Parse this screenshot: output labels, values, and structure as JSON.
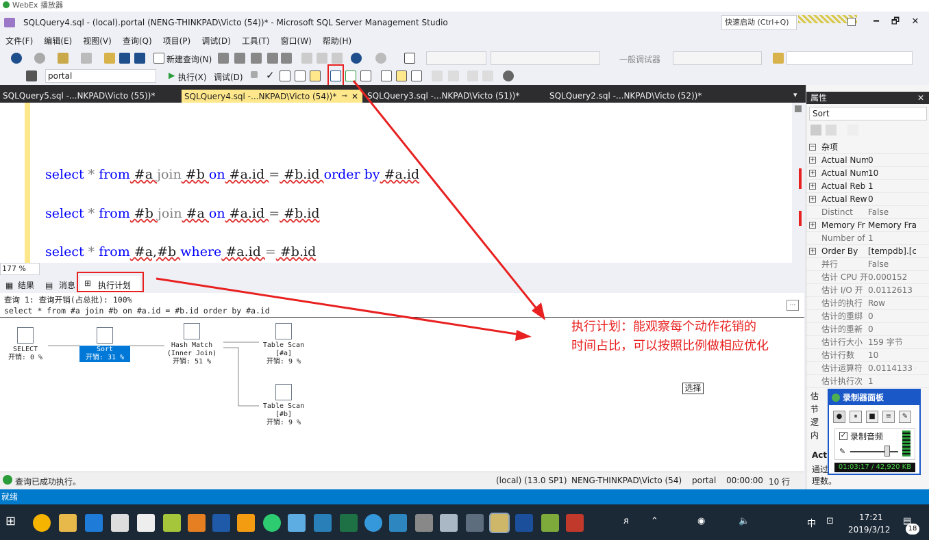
{
  "webex": {
    "title": "WebEx 播放器"
  },
  "window": {
    "title": "SQLQuery4.sql - (local).portal (NENG-THINKPAD\\Victo (54))* - Microsoft SQL Server Management Studio",
    "quick_launch": "快速启动 (Ctrl+Q)",
    "minimize": "━",
    "restore": "🗗",
    "close": "✕"
  },
  "menu": [
    "文件(F)",
    "编辑(E)",
    "视图(V)",
    "查询(Q)",
    "项目(P)",
    "调试(D)",
    "工具(T)",
    "窗口(W)",
    "帮助(H)"
  ],
  "toolbar1": {
    "new_query": "新建查询(N)",
    "debugger": "一般调试器"
  },
  "toolbar2": {
    "database": "portal",
    "execute": "执行(X)",
    "debug": "调试(D)"
  },
  "doc_tabs": [
    {
      "label": "SQLQuery5.sql -...NKPAD\\Victo (55))*",
      "active": false
    },
    {
      "label": "SQLQuery4.sql -...NKPAD\\Victo (54))*",
      "active": true
    },
    {
      "label": "SQLQuery3.sql -...NKPAD\\Victo (51))*",
      "active": false
    },
    {
      "label": "SQLQuery2.sql -...NKPAD\\Victo (52))*",
      "active": false
    }
  ],
  "editor": {
    "lines": [
      {
        "t1": "select",
        "t2": " * ",
        "t3": "from",
        "t4": " #a ",
        "t5": "join",
        "t6": " #b ",
        "t7": "on",
        "t8": " #a.id ",
        "t9": "=",
        "t10": " #b.id ",
        "t11": "order by",
        "t12": " #a.id"
      },
      {
        "t1": "select",
        "t2": " * ",
        "t3": "from",
        "t4": " #b ",
        "t5": "join",
        "t6": " #a ",
        "t7": "on",
        "t8": " #a.id ",
        "t9": "=",
        "t10": " #b.id",
        "t11": "",
        "t12": ""
      },
      {
        "t1": "select",
        "t2": " * ",
        "t3": "from",
        "t4": " #a,#b ",
        "t5": "where",
        "t6": " #a.id ",
        "t7": "=",
        "t8": " #b.id",
        "t9": "",
        "t10": "",
        "t11": "",
        "t12": ""
      }
    ],
    "zoom": "177 %"
  },
  "result_tabs": {
    "results": "结果",
    "messages": "消息",
    "plan": "执行计划"
  },
  "plan": {
    "header1": "查询 1: 查询开销(占总批): 100%",
    "header2": "select * from #a join #b on #a.id = #b.id order by #a.id",
    "nodes": [
      {
        "name": "SELECT",
        "cost": "开销: 0 %"
      },
      {
        "name": "Sort",
        "cost": "开销: 31 %"
      },
      {
        "name": "Hash Match\n(Inner Join)",
        "cost": "开销: 51 %"
      },
      {
        "name": "Table Scan\n[#a]",
        "cost": "开销: 9 %"
      },
      {
        "name": "Table Scan\n[#b]",
        "cost": "开销: 9 %"
      }
    ]
  },
  "status": {
    "message": "查询已成功执行。",
    "server": "(local) (13.0 SP1)",
    "user": "NENG-THINKPAD\\Victo (54)",
    "db": "portal",
    "time": "00:00:00",
    "rows": "10 行"
  },
  "properties": {
    "title": "属性",
    "object": "Sort",
    "category": "杂项",
    "rows": [
      {
        "k": "Actual Num",
        "v": "0",
        "exp": true,
        "dim": false
      },
      {
        "k": "Actual Num",
        "v": "10",
        "exp": true,
        "dim": false
      },
      {
        "k": "Actual Reb",
        "v": "1",
        "exp": true,
        "dim": false
      },
      {
        "k": "Actual Rew",
        "v": "0",
        "exp": true,
        "dim": false
      },
      {
        "k": "Distinct",
        "v": "False",
        "exp": false,
        "dim": true
      },
      {
        "k": "Memory Fr",
        "v": "Memory Fra",
        "exp": true,
        "dim": false
      },
      {
        "k": "Number of",
        "v": "1",
        "exp": false,
        "dim": true
      },
      {
        "k": "Order By",
        "v": "[tempdb].[c",
        "exp": true,
        "dim": false
      },
      {
        "k": "并行",
        "v": "False",
        "exp": false,
        "dim": true
      },
      {
        "k": "估计 CPU 开",
        "v": "0.000152",
        "exp": false,
        "dim": true
      },
      {
        "k": "估计 I/O 开",
        "v": "0.0112613",
        "exp": false,
        "dim": true
      },
      {
        "k": "估计的执行",
        "v": "Row",
        "exp": false,
        "dim": true
      },
      {
        "k": "估计的重绑",
        "v": "0",
        "exp": false,
        "dim": true
      },
      {
        "k": "估计的重新",
        "v": "0",
        "exp": false,
        "dim": true
      },
      {
        "k": "估计行大小",
        "v": "159 字节",
        "exp": false,
        "dim": true
      },
      {
        "k": "估计行数",
        "v": "10",
        "exp": false,
        "dim": true
      },
      {
        "k": "估计运算符",
        "v": "0.0114133 (",
        "exp": false,
        "dim": true
      },
      {
        "k": "估计执行次",
        "v": "1",
        "exp": false,
        "dim": true
      }
    ],
    "partial": [
      "估",
      "节",
      "逻",
      "内"
    ],
    "desc_title": "Actu",
    "desc_text1": "通过",
    "desc_text2": "理数。"
  },
  "recorder": {
    "title": "录制器面板",
    "audio": "录制音频",
    "time": "01:03:17 / 42,920 KB"
  },
  "annotation": {
    "line1": "执行计划：能观察每个动作花销的",
    "line2": "时间占比，可以按照比例做相应优化"
  },
  "select_button": "选择",
  "bottom_status": "就绪",
  "taskbar": {
    "time": "17:21",
    "date": "2019/3/12",
    "ime": "中",
    "badge": "18"
  }
}
